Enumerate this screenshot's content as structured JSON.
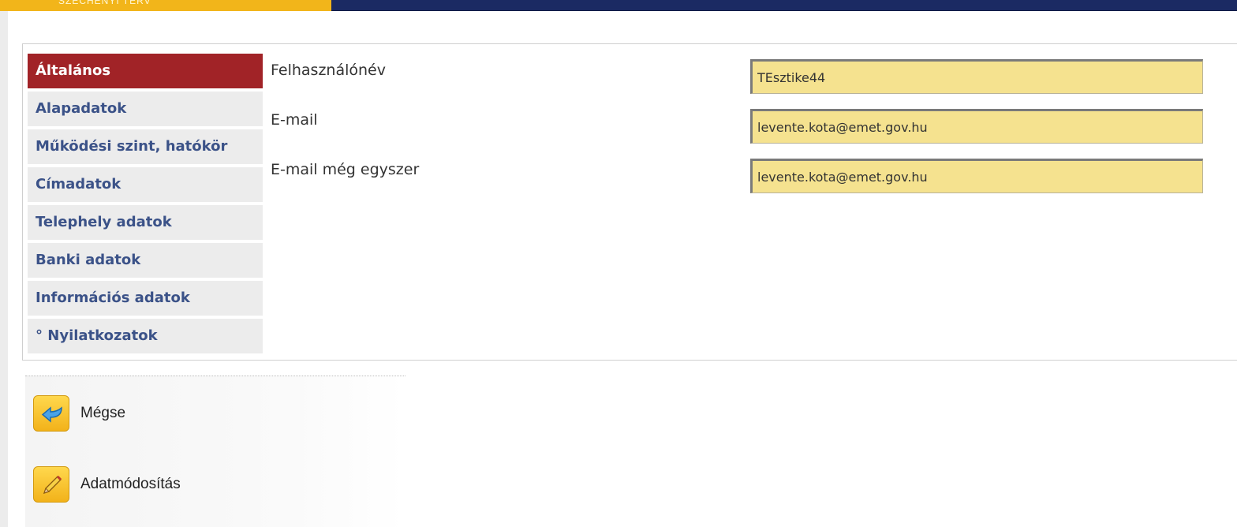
{
  "header": {
    "brand_text": "SZÉCHENYI TERV"
  },
  "sidebar": {
    "items": [
      {
        "label": "Általános",
        "active": true
      },
      {
        "label": "Alapadatok",
        "active": false
      },
      {
        "label": "Működési szint, hatókör",
        "active": false
      },
      {
        "label": "Címadatok",
        "active": false
      },
      {
        "label": "Telephely adatok",
        "active": false
      },
      {
        "label": "Banki adatok",
        "active": false
      },
      {
        "label": "Információs adatok",
        "active": false
      },
      {
        "label": "° Nyilatkozatok",
        "active": false
      }
    ]
  },
  "form": {
    "username_label": "Felhasználónév",
    "username_value": "TEsztike44",
    "email_label": "E-mail",
    "email_value": "levente.kota@emet.gov.hu",
    "email_confirm_label": "E-mail még egyszer",
    "email_confirm_value": "levente.kota@emet.gov.hu"
  },
  "actions": {
    "cancel_label": "Mégse",
    "edit_label": "Adatmódosítás"
  },
  "colors": {
    "active_tab": "#a12327",
    "tab_text": "#3b5288",
    "input_bg": "#f5e28f",
    "header_navy": "#1b2a63",
    "header_gold": "#f2b51a"
  },
  "icons": {
    "cancel": "back-arrow-icon",
    "edit": "pencil-icon"
  }
}
